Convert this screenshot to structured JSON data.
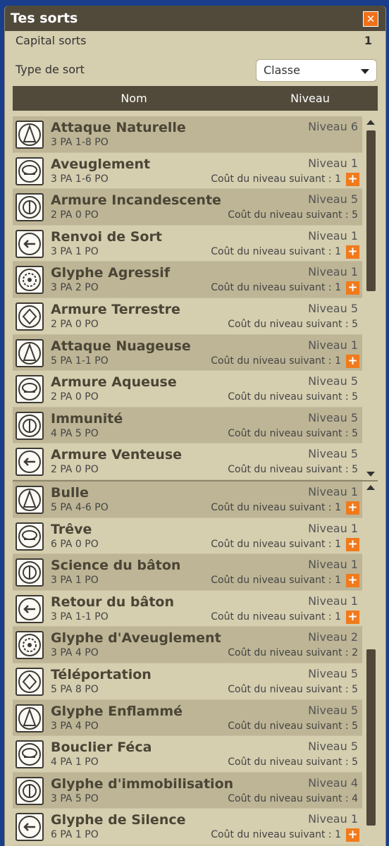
{
  "window": {
    "title": "Tes sorts",
    "close_label": "✕"
  },
  "capital": {
    "label": "Capital sorts",
    "value": "1"
  },
  "type": {
    "label": "Type de sort",
    "selected": "Classe"
  },
  "table": {
    "col_name": "Nom",
    "col_level": "Niveau"
  },
  "list1": [
    {
      "name": "Attaque Naturelle",
      "stats": "3 PA   1-8 PO",
      "level": "Niveau 6",
      "cost": "",
      "plus": false,
      "icon": "natural-attack-icon"
    },
    {
      "name": "Aveuglement",
      "stats": "3 PA   1-6 PO",
      "level": "Niveau 1",
      "cost": "Coût du niveau suivant : 1",
      "plus": true,
      "icon": "blindness-icon"
    },
    {
      "name": "Armure Incandescente",
      "stats": "2 PA   0 PO",
      "level": "Niveau 5",
      "cost": "Coût du niveau suivant : 5",
      "plus": false,
      "icon": "fire-armor-icon"
    },
    {
      "name": "Renvoi de Sort",
      "stats": "3 PA   1 PO",
      "level": "Niveau 1",
      "cost": "Coût du niveau suivant : 1",
      "plus": true,
      "icon": "spell-reflect-icon"
    },
    {
      "name": "Glyphe Agressif",
      "stats": "3 PA   2 PO",
      "level": "Niveau 1",
      "cost": "Coût du niveau suivant : 1",
      "plus": true,
      "icon": "aggressive-glyph-icon"
    },
    {
      "name": "Armure Terrestre",
      "stats": "2 PA   0 PO",
      "level": "Niveau 5",
      "cost": "Coût du niveau suivant : 5",
      "plus": false,
      "icon": "earth-armor-icon"
    },
    {
      "name": "Attaque Nuageuse",
      "stats": "5 PA   1-1 PO",
      "level": "Niveau 1",
      "cost": "Coût du niveau suivant : 1",
      "plus": true,
      "icon": "cloud-attack-icon"
    },
    {
      "name": "Armure Aqueuse",
      "stats": "2 PA   0 PO",
      "level": "Niveau 5",
      "cost": "Coût du niveau suivant : 5",
      "plus": false,
      "icon": "water-armor-icon"
    },
    {
      "name": "Immunité",
      "stats": "4 PA   5 PO",
      "level": "Niveau 5",
      "cost": "Coût du niveau suivant : 5",
      "plus": false,
      "icon": "immunity-icon"
    },
    {
      "name": "Armure Venteuse",
      "stats": "2 PA   0 PO",
      "level": "Niveau 5",
      "cost": "Coût du niveau suivant : 5",
      "plus": false,
      "icon": "wind-armor-icon"
    }
  ],
  "list2": [
    {
      "name": "Bulle",
      "stats": "5 PA   4-6 PO",
      "level": "Niveau 1",
      "cost": "Coût du niveau suivant : 1",
      "plus": true,
      "icon": "bubble-icon"
    },
    {
      "name": "Trêve",
      "stats": "6 PA   0 PO",
      "level": "Niveau 1",
      "cost": "Coût du niveau suivant : 1",
      "plus": true,
      "icon": "truce-icon"
    },
    {
      "name": "Science du bâton",
      "stats": "3 PA   1 PO",
      "level": "Niveau 1",
      "cost": "Coût du niveau suivant : 1",
      "plus": true,
      "icon": "staff-science-icon"
    },
    {
      "name": "Retour du bâton",
      "stats": "3 PA   1-1 PO",
      "level": "Niveau 1",
      "cost": "Coût du niveau suivant : 1",
      "plus": true,
      "icon": "staff-return-icon"
    },
    {
      "name": "Glyphe d'Aveuglement",
      "stats": "3 PA   4 PO",
      "level": "Niveau 2",
      "cost": "Coût du niveau suivant : 2",
      "plus": false,
      "icon": "blinding-glyph-icon"
    },
    {
      "name": "Téléportation",
      "stats": "5 PA   8 PO",
      "level": "Niveau 5",
      "cost": "Coût du niveau suivant : 5",
      "plus": false,
      "icon": "teleport-icon"
    },
    {
      "name": "Glyphe Enflammé",
      "stats": "3 PA   4 PO",
      "level": "Niveau 5",
      "cost": "Coût du niveau suivant : 5",
      "plus": false,
      "icon": "burning-glyph-icon"
    },
    {
      "name": "Bouclier Féca",
      "stats": "4 PA   1 PO",
      "level": "Niveau 5",
      "cost": "Coût du niveau suivant : 5",
      "plus": false,
      "icon": "feca-shield-icon"
    },
    {
      "name": "Glyphe d'immobilisation",
      "stats": "3 PA   5 PO",
      "level": "Niveau 4",
      "cost": "Coût du niveau suivant : 4",
      "plus": false,
      "icon": "immobilization-glyph-icon"
    },
    {
      "name": "Glyphe de Silence",
      "stats": "6 PA   1 PO",
      "level": "Niveau 1",
      "cost": "Coût du niveau suivant : 1",
      "plus": true,
      "icon": "silence-glyph-icon"
    }
  ],
  "colors": {
    "header": "#514a3b",
    "panel": "#d5ceaf",
    "row_dark": "#bdb595",
    "accent": "#f07a1c"
  }
}
